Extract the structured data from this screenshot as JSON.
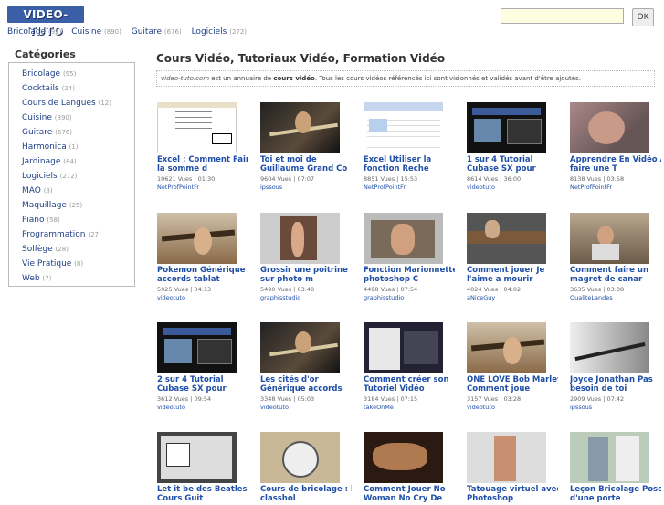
{
  "header": {
    "logo": "VIDEO-TUTO",
    "search_placeholder": "",
    "ok_label": "OK",
    "nav": [
      {
        "label": "Bricolage",
        "count": "(95)"
      },
      {
        "label": "Cuisine",
        "count": "(890)"
      },
      {
        "label": "Guitare",
        "count": "(676)"
      },
      {
        "label": "Logiciels",
        "count": "(272)"
      }
    ]
  },
  "sidebar": {
    "title": "Catégories",
    "items": [
      {
        "label": "Bricolage",
        "count": "(95)"
      },
      {
        "label": "Cocktails",
        "count": "(24)"
      },
      {
        "label": "Cours de Langues",
        "count": "(12)"
      },
      {
        "label": "Cuisine",
        "count": "(890)"
      },
      {
        "label": "Guitare",
        "count": "(676)"
      },
      {
        "label": "Harmonica",
        "count": "(1)"
      },
      {
        "label": "Jardinage",
        "count": "(84)"
      },
      {
        "label": "Logiciels",
        "count": "(272)"
      },
      {
        "label": "MAO",
        "count": "(3)"
      },
      {
        "label": "Maquillage",
        "count": "(25)"
      },
      {
        "label": "Piano",
        "count": "(58)"
      },
      {
        "label": "Programmation",
        "count": "(27)"
      },
      {
        "label": "Solfège",
        "count": "(28)"
      },
      {
        "label": "Vie Pratique",
        "count": "(8)"
      },
      {
        "label": "Web",
        "count": "(7)"
      }
    ]
  },
  "main": {
    "title": "Cours Vidéo, Tutoriaux Vidéo, Formation Vidéo",
    "intro_site": "video-tuto.com",
    "intro_mid": " est un annuaire de ",
    "intro_bold": "cours vidéo",
    "intro_end": ". Tous les cours vidéos référencés ici sont visionnés et validés avant d'être ajoutés.",
    "videos": [
      {
        "t1": "Excel : Comment Faire",
        "t2": "la somme d",
        "meta": "10621 Vues | 01:30",
        "author": "NetProfPointFr",
        "thumb": "spreadsheet"
      },
      {
        "t1": "Toi et moi de",
        "t2": "Guillaume Grand Co",
        "meta": "9604 Vues | 07:07",
        "author": "ipssous",
        "thumb": "guitar-dark"
      },
      {
        "t1": "Excel Utiliser la",
        "t2": "fonction Reche",
        "meta": "8851 Vues | 15:53",
        "author": "NetProfPointFr",
        "thumb": "spreadsheet-blue"
      },
      {
        "t1": "1 sur 4 Tutorial",
        "t2": "Cubase SX pour",
        "meta": "8614 Vues | 36:00",
        "author": "videotuto",
        "thumb": "software-dark"
      },
      {
        "t1": "Apprendre En Vidéo A",
        "t2": "faire une T",
        "meta": "8138 Vues | 03:58",
        "author": "NetProfPointFr",
        "thumb": "hands"
      },
      {
        "t1": "Pokemon Générique",
        "t2": "accords tablat",
        "meta": "5925 Vues | 04:13",
        "author": "videotuto",
        "thumb": "guitar-light"
      },
      {
        "t1": "Grossir une poitrine",
        "t2": "sur photo m",
        "meta": "5490 Vues | 03:40",
        "author": "graphisstudio",
        "thumb": "photo-edit"
      },
      {
        "t1": "Fonction Marionnette",
        "t2": "photoshop C",
        "meta": "4498 Vues | 07:54",
        "author": "graphisstudio",
        "thumb": "photoshop"
      },
      {
        "t1": "Comment jouer Je",
        "t2": "l'aime a mourir",
        "meta": "4024 Vues | 04:02",
        "author": "aNiceGuy",
        "thumb": "guitar-neck"
      },
      {
        "t1": "Comment faire un",
        "t2": "magret de canar",
        "meta": "3635 Vues | 03:08",
        "author": "QualiteLandes",
        "thumb": "kitchen"
      },
      {
        "t1": "2 sur 4 Tutorial",
        "t2": "Cubase SX pour",
        "meta": "3612 Vues | 09:54",
        "author": "videotuto",
        "thumb": "software-dark"
      },
      {
        "t1": "Les cités d'or",
        "t2": "Générique accords",
        "meta": "3348 Vues | 05:03",
        "author": "videotuto",
        "thumb": "guitar-dark"
      },
      {
        "t1": "Comment créer son",
        "t2": "Tutoriel Vidéo",
        "meta": "3184 Vues | 07:15",
        "author": "takeOnMe",
        "thumb": "menu"
      },
      {
        "t1": "ONE LOVE Bob Marley",
        "t2": "Comment joue",
        "meta": "3157 Vues | 03:28",
        "author": "videotuto",
        "thumb": "guitar-light"
      },
      {
        "t1": "Joyce Jonathan Pas",
        "t2": "besoin de toi",
        "meta": "2909 Vues | 07:42",
        "author": "ipssous",
        "thumb": "guitar-bw"
      },
      {
        "t1": "Let it be des Beatles",
        "t2": "Cours Guit",
        "meta": "",
        "author": "",
        "thumb": "notation"
      },
      {
        "t1": "Cours de bricolage : la",
        "t2": "classhol",
        "meta": "",
        "author": "",
        "thumb": "tools"
      },
      {
        "t1": "Comment Jouer No",
        "t2": "Woman No Cry De",
        "meta": "",
        "author": "",
        "thumb": "guitar-hands"
      },
      {
        "t1": "Tatouage virtuel avec",
        "t2": "Photoshop",
        "meta": "",
        "author": "",
        "thumb": "tattoo"
      },
      {
        "t1": "Leçon Bricolage Pose",
        "t2": "d'une porte",
        "meta": "",
        "author": "",
        "thumb": "door"
      }
    ]
  }
}
